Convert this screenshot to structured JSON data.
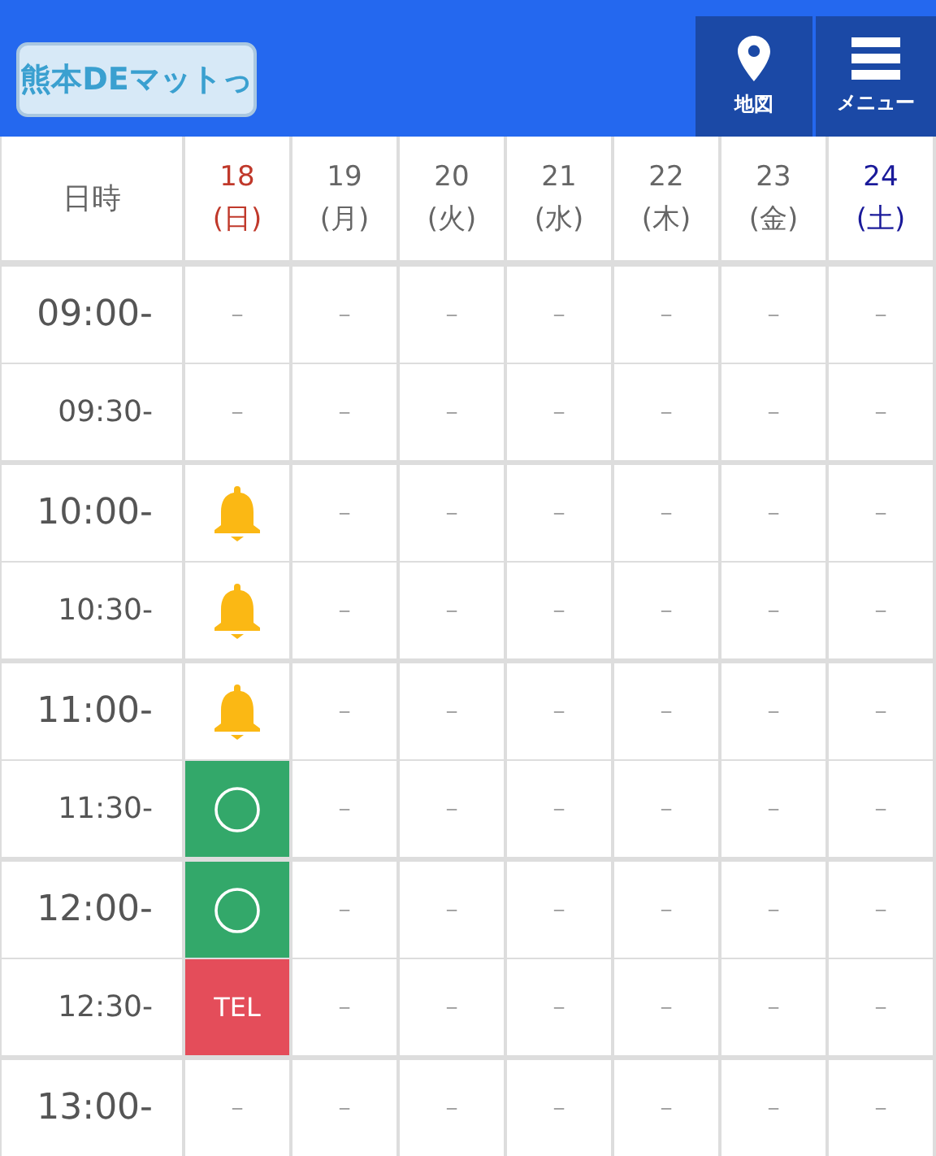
{
  "header": {
    "logo": "熊本DEマットっ",
    "nav": [
      {
        "kind": "map",
        "label": "地図"
      },
      {
        "kind": "menu",
        "label": "メニュー"
      }
    ]
  },
  "table": {
    "corner": "日時",
    "days": [
      {
        "date": "18",
        "weekday": "(日)",
        "kind": "sunday"
      },
      {
        "date": "19",
        "weekday": "(月)",
        "kind": "weekday"
      },
      {
        "date": "20",
        "weekday": "(火)",
        "kind": "weekday"
      },
      {
        "date": "21",
        "weekday": "(水)",
        "kind": "weekday"
      },
      {
        "date": "22",
        "weekday": "(木)",
        "kind": "weekday"
      },
      {
        "date": "23",
        "weekday": "(金)",
        "kind": "weekday"
      },
      {
        "date": "24",
        "weekday": "(土)",
        "kind": "saturday"
      }
    ],
    "rows": [
      {
        "time": "09:00-",
        "kind": "hour",
        "cells": [
          {
            "kind": "none",
            "text": "－"
          },
          {
            "kind": "none",
            "text": "－"
          },
          {
            "kind": "none",
            "text": "－"
          },
          {
            "kind": "none",
            "text": "－"
          },
          {
            "kind": "none",
            "text": "－"
          },
          {
            "kind": "none",
            "text": "－"
          },
          {
            "kind": "none",
            "text": "－"
          }
        ]
      },
      {
        "time": "09:30-",
        "kind": "half",
        "cells": [
          {
            "kind": "none",
            "text": "－"
          },
          {
            "kind": "none",
            "text": "－"
          },
          {
            "kind": "none",
            "text": "－"
          },
          {
            "kind": "none",
            "text": "－"
          },
          {
            "kind": "none",
            "text": "－"
          },
          {
            "kind": "none",
            "text": "－"
          },
          {
            "kind": "none",
            "text": "－"
          }
        ]
      },
      {
        "time": "10:00-",
        "kind": "hour",
        "cells": [
          {
            "kind": "bell"
          },
          {
            "kind": "none",
            "text": "－"
          },
          {
            "kind": "none",
            "text": "－"
          },
          {
            "kind": "none",
            "text": "－"
          },
          {
            "kind": "none",
            "text": "－"
          },
          {
            "kind": "none",
            "text": "－"
          },
          {
            "kind": "none",
            "text": "－"
          }
        ]
      },
      {
        "time": "10:30-",
        "kind": "half",
        "cells": [
          {
            "kind": "bell"
          },
          {
            "kind": "none",
            "text": "－"
          },
          {
            "kind": "none",
            "text": "－"
          },
          {
            "kind": "none",
            "text": "－"
          },
          {
            "kind": "none",
            "text": "－"
          },
          {
            "kind": "none",
            "text": "－"
          },
          {
            "kind": "none",
            "text": "－"
          }
        ]
      },
      {
        "time": "11:00-",
        "kind": "hour",
        "cells": [
          {
            "kind": "bell"
          },
          {
            "kind": "none",
            "text": "－"
          },
          {
            "kind": "none",
            "text": "－"
          },
          {
            "kind": "none",
            "text": "－"
          },
          {
            "kind": "none",
            "text": "－"
          },
          {
            "kind": "none",
            "text": "－"
          },
          {
            "kind": "none",
            "text": "－"
          }
        ]
      },
      {
        "time": "11:30-",
        "kind": "half",
        "cells": [
          {
            "kind": "open"
          },
          {
            "kind": "none",
            "text": "－"
          },
          {
            "kind": "none",
            "text": "－"
          },
          {
            "kind": "none",
            "text": "－"
          },
          {
            "kind": "none",
            "text": "－"
          },
          {
            "kind": "none",
            "text": "－"
          },
          {
            "kind": "none",
            "text": "－"
          }
        ]
      },
      {
        "time": "12:00-",
        "kind": "hour",
        "cells": [
          {
            "kind": "open"
          },
          {
            "kind": "none",
            "text": "－"
          },
          {
            "kind": "none",
            "text": "－"
          },
          {
            "kind": "none",
            "text": "－"
          },
          {
            "kind": "none",
            "text": "－"
          },
          {
            "kind": "none",
            "text": "－"
          },
          {
            "kind": "none",
            "text": "－"
          }
        ]
      },
      {
        "time": "12:30-",
        "kind": "half",
        "cells": [
          {
            "kind": "tel",
            "text": "TEL"
          },
          {
            "kind": "none",
            "text": "－"
          },
          {
            "kind": "none",
            "text": "－"
          },
          {
            "kind": "none",
            "text": "－"
          },
          {
            "kind": "none",
            "text": "－"
          },
          {
            "kind": "none",
            "text": "－"
          },
          {
            "kind": "none",
            "text": "－"
          }
        ]
      },
      {
        "time": "13:00-",
        "kind": "hour",
        "cells": [
          {
            "kind": "none",
            "text": "－"
          },
          {
            "kind": "none",
            "text": "－"
          },
          {
            "kind": "none",
            "text": "－"
          },
          {
            "kind": "none",
            "text": "－"
          },
          {
            "kind": "none",
            "text": "－"
          },
          {
            "kind": "none",
            "text": "－"
          },
          {
            "kind": "none",
            "text": "－"
          }
        ]
      }
    ]
  }
}
